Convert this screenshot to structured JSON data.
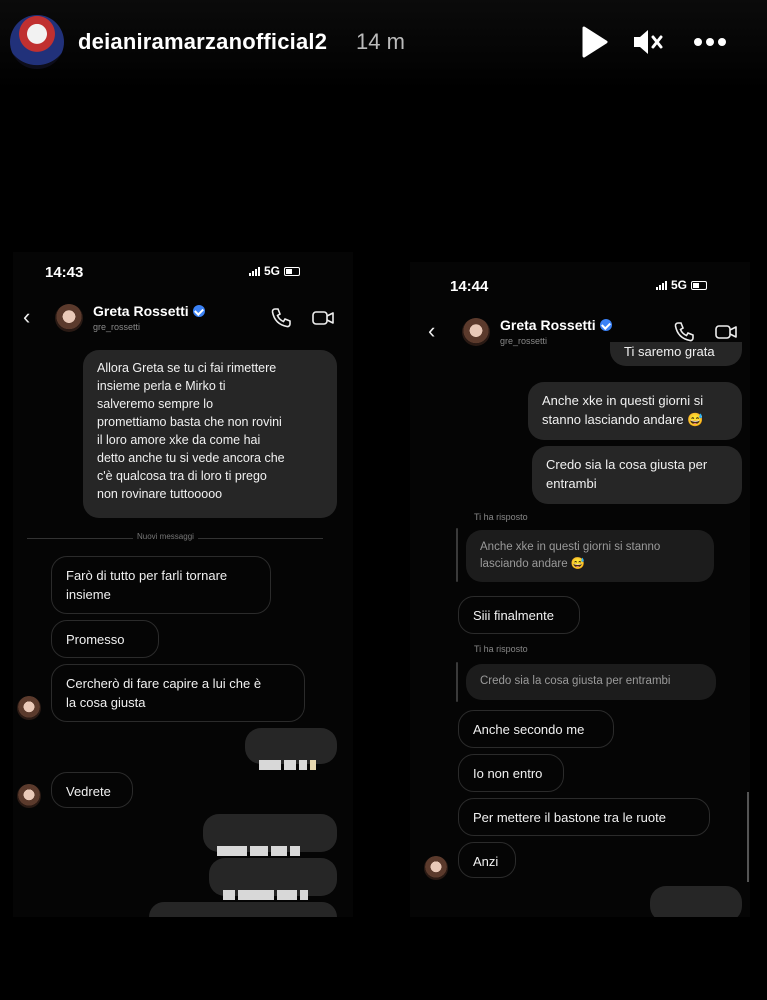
{
  "story": {
    "username": "deianiramarzanofficial2",
    "time_ago": "14 m",
    "icons": [
      "play-icon",
      "mute-icon",
      "more-icon"
    ]
  },
  "left_screen": {
    "status_time": "14:43",
    "network": "5G",
    "contact_name": "Greta Rossetti",
    "contact_handle": "gre_rossetti",
    "msg_sent_long": "Allora Greta se tu ci fai rimettere\ninsieme perla e Mirko ti\nsalveremo sempre lo\npromettiamo basta che non rovini\nil loro amore xke da come hai\ndetto anche tu si vede ancora che\nc'è qualcosa tra di loro ti prego\nnon rovinare tuttooooo",
    "new_messages_label": "Nuovi messaggi",
    "msg_1": "Farò di tutto per farli tornare\ninsieme",
    "msg_2": "Promesso",
    "msg_3": "Cercherò di fare capire a lui che è\nla cosa giusta",
    "msg_4": "Vedrete"
  },
  "right_screen": {
    "status_time": "14:44",
    "network": "5G",
    "contact_name": "Greta Rossetti",
    "contact_handle": "gre_rossetti",
    "msg_cut_top": "Ti saremo grata",
    "msg_sent_1": "Anche xke in questi giorni si\nstanno lasciando andare 😅",
    "msg_sent_2": "Credo sia la cosa giusta per\nentrambi",
    "replied_label_1": "Ti ha risposto",
    "quote_1": "Anche xke in questi giorni si stanno\nlasciando andare 😅",
    "msg_1": "Siii finalmente",
    "replied_label_2": "Ti ha risposto",
    "quote_2": "Credo sia la cosa giusta per entrambi",
    "msg_2": "Anche secondo me",
    "msg_3": "Io non entro",
    "msg_4": "Per mettere il bastone tra le ruote",
    "msg_5": "Anzi"
  }
}
